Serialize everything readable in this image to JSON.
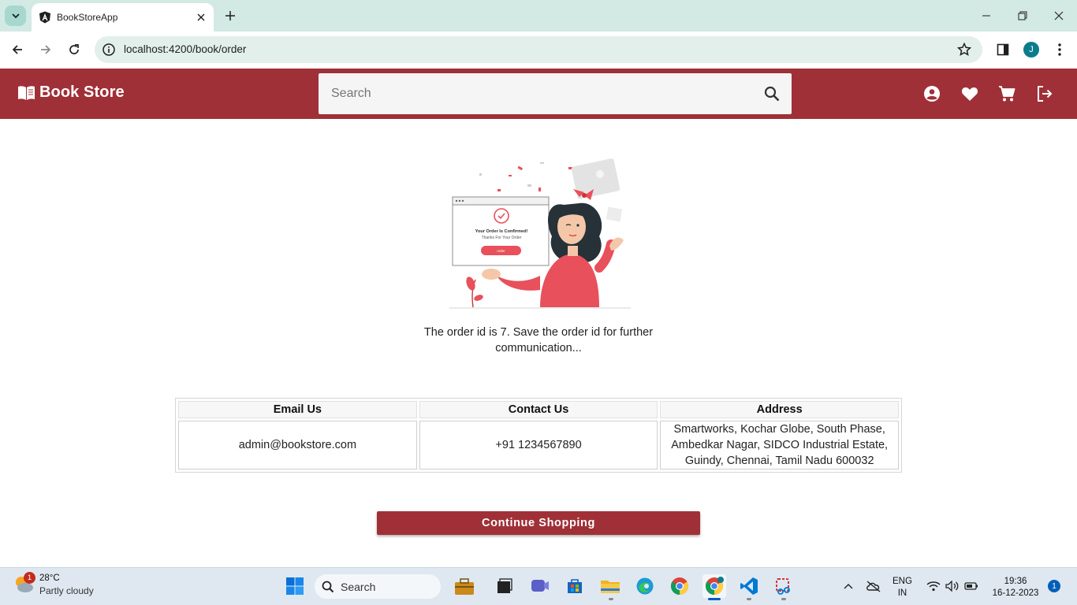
{
  "browser": {
    "tab_title": "BookStoreApp",
    "url": "localhost:4200/book/order",
    "profile_initial": "J"
  },
  "header": {
    "brand": "Book Store",
    "search_placeholder": "Search",
    "icons": [
      "account-icon",
      "wishlist-icon",
      "cart-icon",
      "logout-icon"
    ]
  },
  "order": {
    "illustration_title": "Your Order Is Confirmed!",
    "illustration_subtitle": "Thanks For Your Order",
    "illustration_button": "order",
    "message": "The order id is 7. Save the order id for further communication..."
  },
  "contact_table": {
    "headers": [
      "Email Us",
      "Contact Us",
      "Address"
    ],
    "row": [
      "admin@bookstore.com",
      "+91 1234567890",
      "Smartworks, Kochar Globe, South Phase, Ambedkar Nagar, SIDCO Industrial Estate, Guindy, Chennai, Tamil Nadu 600032"
    ]
  },
  "continue_button": "Continue Shopping",
  "taskbar": {
    "weather_temp": "28°C",
    "weather_desc": "Partly cloudy",
    "weather_badge": "1",
    "search_label": "Search",
    "lang": "ENG",
    "region": "IN",
    "time": "19:36",
    "date": "16-12-2023",
    "notifications": "1"
  },
  "colors": {
    "brand": "#a03037",
    "tab_bar": "#d3e9e3",
    "omnibox": "#e2efea"
  }
}
